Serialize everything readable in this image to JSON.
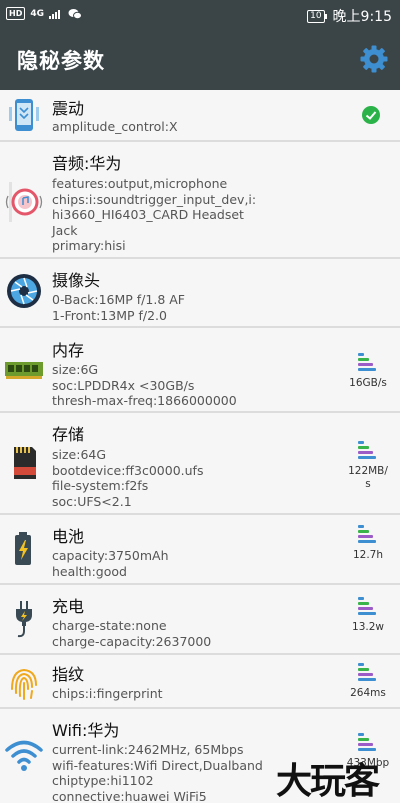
{
  "status_bar": {
    "hd": "HD",
    "network": "4G",
    "battery": "10",
    "time": "晚上9:15"
  },
  "toolbar": {
    "title": "隐秘参数"
  },
  "items": [
    {
      "name": "震动",
      "icon": "vibration-phone-icon",
      "details": [
        "amplitude_control:X"
      ],
      "status": "check"
    },
    {
      "name": "音频:华为",
      "icon": "audio-speaker-icon",
      "details": [
        "features:output,microphone",
        "chips:i:soundtrigger_input_dev,i:\nhi3660_HI6403_CARD Headset\nJack",
        "primary:hisi"
      ]
    },
    {
      "name": "摄像头",
      "icon": "camera-aperture-icon",
      "details": [
        "0-Back:16MP f/1.8 AF",
        "1-Front:13MP f/2.0"
      ]
    },
    {
      "name": "内存",
      "icon": "memory-chip-icon",
      "details": [
        "size:6G",
        "soc:LPDDR4x <30GB/s",
        "thresh-max-freq:1866000000"
      ],
      "metric": "16GB/s"
    },
    {
      "name": "存储",
      "icon": "sd-card-icon",
      "details": [
        "size:64G",
        "bootdevice:ff3c0000.ufs",
        "file-system:f2fs",
        "soc:UFS<2.1"
      ],
      "metric": "122MB/\ns"
    },
    {
      "name": "电池",
      "icon": "battery-charging-icon",
      "details": [
        "capacity:3750mAh",
        "health:good"
      ],
      "metric": "12.7h"
    },
    {
      "name": "充电",
      "icon": "charger-plug-icon",
      "details": [
        "charge-state:none",
        "charge-capacity:2637000"
      ],
      "metric": "13.2w"
    },
    {
      "name": "指纹",
      "icon": "fingerprint-icon",
      "details": [
        "chips:i:fingerprint"
      ],
      "metric": "264ms"
    },
    {
      "name": "Wifi:华为",
      "icon": "wifi-icon",
      "details": [
        "current-link:2462MHz, 65Mbps",
        "wifi-features:Wifi Direct,Dualband",
        "chiptype:hi1102",
        "connective:huawei WiFi5"
      ],
      "metric": "433Mbp"
    }
  ],
  "watermark": "大玩客",
  "colors": {
    "toolbar": "#3b4548",
    "accent": "#3d8fd1",
    "check": "#2bb34a"
  }
}
